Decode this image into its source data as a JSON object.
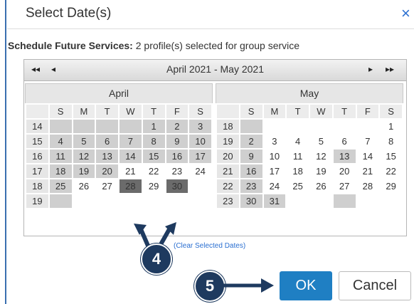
{
  "dialog": {
    "title": "Select Date(s)",
    "close_icon": "×"
  },
  "subtitle": {
    "label": "Schedule Future Services:",
    "text": " 2 profile(s) selected for group service"
  },
  "calendar": {
    "range_label": "April 2021 - May 2021",
    "nav": {
      "first": "◀◀",
      "prev": "◀",
      "next": "▶",
      "last": "▶▶"
    },
    "dow": [
      "S",
      "M",
      "T",
      "W",
      "T",
      "F",
      "S"
    ],
    "months": [
      {
        "name": "April",
        "weeks": [
          {
            "wk": "14",
            "days": [
              [
                "",
                "past"
              ],
              [
                "",
                "past"
              ],
              [
                "",
                "past"
              ],
              [
                "",
                "past"
              ],
              [
                "1",
                "past"
              ],
              [
                "2",
                "past"
              ],
              [
                "3",
                "past"
              ]
            ]
          },
          {
            "wk": "15",
            "days": [
              [
                "4",
                "past"
              ],
              [
                "5",
                "past"
              ],
              [
                "6",
                "past"
              ],
              [
                "7",
                "past"
              ],
              [
                "8",
                "past"
              ],
              [
                "9",
                "past"
              ],
              [
                "10",
                "past"
              ]
            ]
          },
          {
            "wk": "16",
            "days": [
              [
                "11",
                "past"
              ],
              [
                "12",
                "past"
              ],
              [
                "13",
                "past"
              ],
              [
                "14",
                "past"
              ],
              [
                "15",
                "past"
              ],
              [
                "16",
                "past"
              ],
              [
                "17",
                "past"
              ]
            ]
          },
          {
            "wk": "17",
            "days": [
              [
                "18",
                "past"
              ],
              [
                "19",
                "past"
              ],
              [
                "20",
                "past"
              ],
              [
                "21",
                "day"
              ],
              [
                "22",
                "day"
              ],
              [
                "23",
                "day"
              ],
              [
                "24",
                "day"
              ]
            ]
          },
          {
            "wk": "18",
            "days": [
              [
                "25",
                "past"
              ],
              [
                "26",
                "day"
              ],
              [
                "27",
                "day"
              ],
              [
                "28",
                "sel"
              ],
              [
                "29",
                "day"
              ],
              [
                "30",
                "sel"
              ],
              [
                "",
                "blank"
              ]
            ]
          },
          {
            "wk": "19",
            "days": [
              [
                "",
                "past"
              ],
              [
                "",
                "blank"
              ],
              [
                "",
                "blank"
              ],
              [
                "",
                "blank"
              ],
              [
                "",
                "blank"
              ],
              [
                "",
                "blank"
              ],
              [
                "",
                "blank"
              ]
            ]
          }
        ]
      },
      {
        "name": "May",
        "weeks": [
          {
            "wk": "18",
            "days": [
              [
                "",
                "past"
              ],
              [
                "",
                "blank"
              ],
              [
                "",
                "blank"
              ],
              [
                "",
                "blank"
              ],
              [
                "",
                "blank"
              ],
              [
                "",
                "blank"
              ],
              [
                "1",
                "day"
              ]
            ]
          },
          {
            "wk": "19",
            "days": [
              [
                "2",
                "past"
              ],
              [
                "3",
                "day"
              ],
              [
                "4",
                "day"
              ],
              [
                "5",
                "day"
              ],
              [
                "6",
                "day"
              ],
              [
                "7",
                "day"
              ],
              [
                "8",
                "day"
              ]
            ]
          },
          {
            "wk": "20",
            "days": [
              [
                "9",
                "past"
              ],
              [
                "10",
                "day"
              ],
              [
                "11",
                "day"
              ],
              [
                "12",
                "day"
              ],
              [
                "13",
                "past"
              ],
              [
                "14",
                "day"
              ],
              [
                "15",
                "day"
              ]
            ]
          },
          {
            "wk": "21",
            "days": [
              [
                "16",
                "past"
              ],
              [
                "17",
                "day"
              ],
              [
                "18",
                "day"
              ],
              [
                "19",
                "day"
              ],
              [
                "20",
                "day"
              ],
              [
                "21",
                "day"
              ],
              [
                "22",
                "day"
              ]
            ]
          },
          {
            "wk": "22",
            "days": [
              [
                "23",
                "past"
              ],
              [
                "24",
                "day"
              ],
              [
                "25",
                "day"
              ],
              [
                "26",
                "day"
              ],
              [
                "27",
                "day"
              ],
              [
                "28",
                "day"
              ],
              [
                "29",
                "day"
              ]
            ]
          },
          {
            "wk": "23",
            "days": [
              [
                "30",
                "past"
              ],
              [
                "31",
                "past"
              ],
              [
                "",
                "blank"
              ],
              [
                "",
                "blank"
              ],
              [
                "",
                "past"
              ],
              [
                "",
                "blank"
              ],
              [
                "",
                "blank"
              ]
            ]
          }
        ]
      }
    ]
  },
  "clear_link": "(Clear Selected Dates)",
  "callouts": {
    "step4": "4",
    "step5": "5"
  },
  "buttons": {
    "ok": "OK",
    "cancel": "Cancel"
  },
  "colors": {
    "accent": "#1f7fc3",
    "callout": "#1e3a5f",
    "selected": "#6b6b6b"
  }
}
